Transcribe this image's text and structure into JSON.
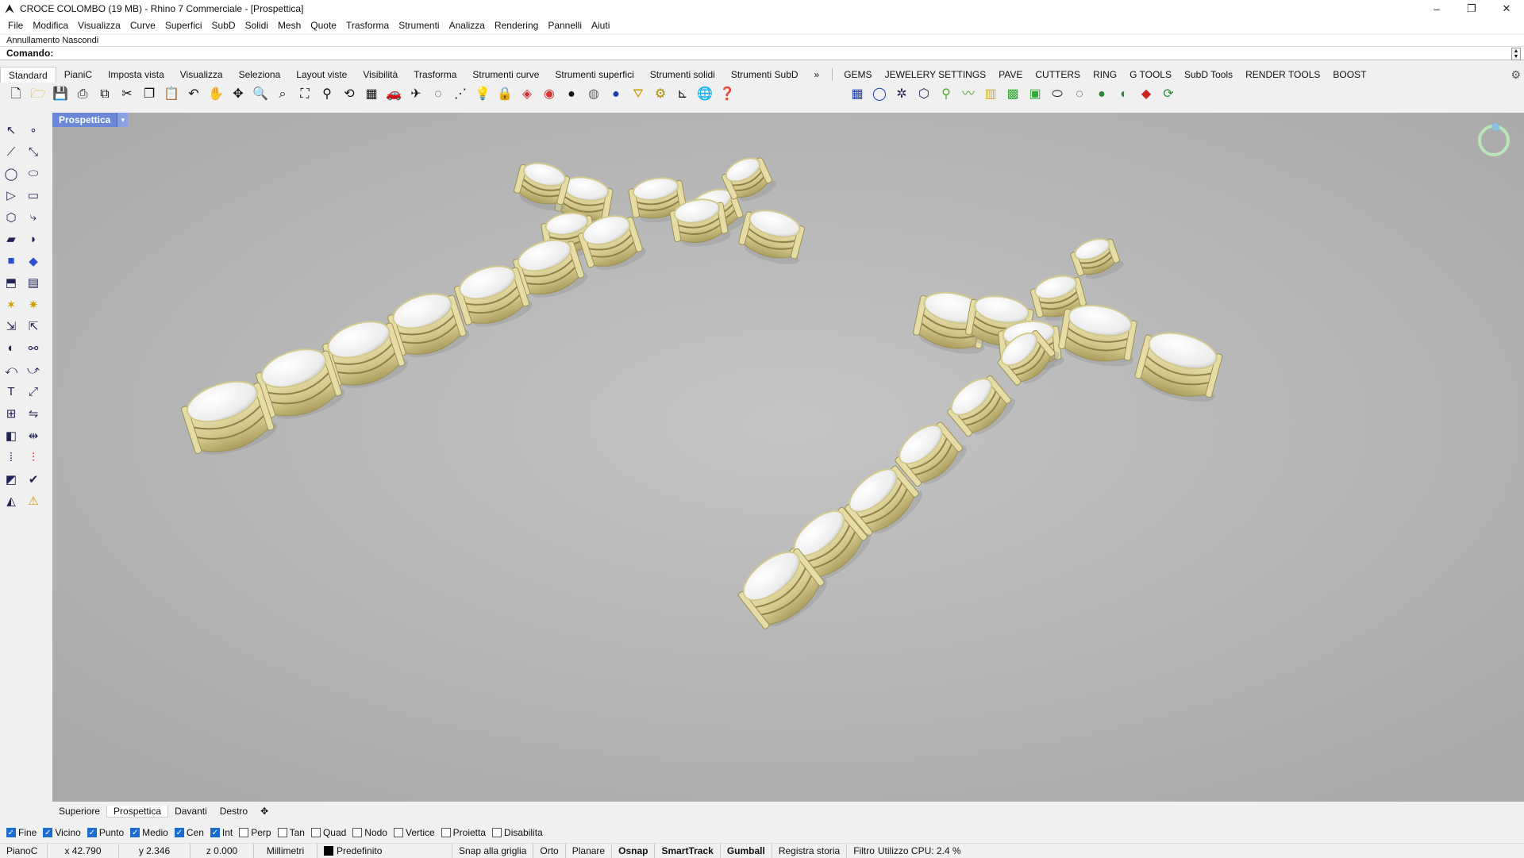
{
  "window": {
    "title": "CROCE COLOMBO (19 MB) - Rhino 7 Commerciale - [Prospettica]",
    "controls": [
      "–",
      "❐",
      "✕"
    ]
  },
  "menu": [
    "File",
    "Modifica",
    "Visualizza",
    "Curve",
    "Superfici",
    "SubD",
    "Solidi",
    "Mesh",
    "Quote",
    "Trasforma",
    "Strumenti",
    "Analizza",
    "Rendering",
    "Pannelli",
    "Aiuti"
  ],
  "command": {
    "history": "Annullamento Nascondi",
    "label": "Comando:",
    "value": ""
  },
  "tabs": {
    "main": [
      "Standard",
      "PianiC",
      "Imposta vista",
      "Visualizza",
      "Seleziona",
      "Layout viste",
      "Visibilità",
      "Trasforma",
      "Strumenti curve",
      "Strumenti superfici",
      "Strumenti solidi",
      "Strumenti SubD"
    ],
    "overflow": "»",
    "plugins": [
      "GEMS",
      "JEWELERY SETTINGS",
      "PAVE",
      "CUTTERS",
      "RING",
      "G TOOLS",
      "SubD Tools",
      "RENDER TOOLS",
      "BOOST"
    ]
  },
  "viewport": {
    "name": "Prospettica",
    "dropdown": "▾",
    "background": "#b6b6b6",
    "metal_color": "#d9cf96",
    "gem_color": "#f4f4f4"
  },
  "viewport_tabs": [
    "Superiore",
    "Prospettica",
    "Davanti",
    "Destro",
    "✥"
  ],
  "osnaps": [
    {
      "label": "Fine",
      "checked": true
    },
    {
      "label": "Vicino",
      "checked": true
    },
    {
      "label": "Punto",
      "checked": true
    },
    {
      "label": "Medio",
      "checked": true
    },
    {
      "label": "Cen",
      "checked": true
    },
    {
      "label": "Int",
      "checked": true
    },
    {
      "label": "Perp",
      "checked": false
    },
    {
      "label": "Tan",
      "checked": false
    },
    {
      "label": "Quad",
      "checked": false
    },
    {
      "label": "Nodo",
      "checked": false
    },
    {
      "label": "Vertice",
      "checked": false
    },
    {
      "label": "Proietta",
      "checked": false
    },
    {
      "label": "Disabilita",
      "checked": false
    }
  ],
  "status": {
    "plane": "PianoC",
    "x": "x 42.790",
    "y": "y 2.346",
    "z": "z 0.000",
    "units": "Millimetri",
    "layer": "Predefinito",
    "toggles": [
      "Snap alla griglia",
      "Orto",
      "Planare",
      "Osnap",
      "SmartTrack",
      "Gumball",
      "Registra storia",
      "Filtro"
    ],
    "cpu": "Utilizzo CPU: 2.4 %"
  }
}
